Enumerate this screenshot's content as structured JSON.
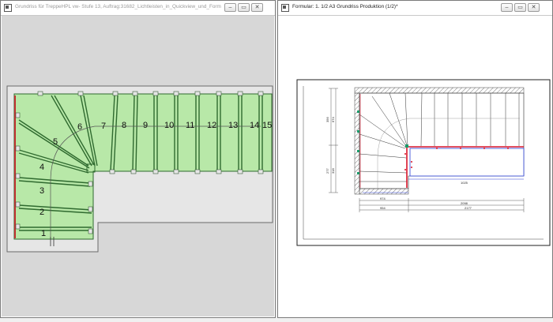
{
  "left_window": {
    "title": "Grundriss für TreppeHPL vw- Stufe 13, Auftrag:31682_Lichtleisten_in_Quickview_und_Form",
    "icon": "floorplan-window-icon",
    "controls": {
      "minimize": "–",
      "maximize": "▭",
      "close": "✕"
    },
    "step_numbers": [
      "1",
      "2",
      "3",
      "4",
      "5",
      "6",
      "7",
      "8",
      "9",
      "10",
      "11",
      "12",
      "13",
      "14",
      "15"
    ],
    "colors": {
      "tread_fill": "#b8e8a8",
      "step_line": "#2f6a2f",
      "wall": "#808080",
      "background": "#d7d7d7"
    }
  },
  "right_window": {
    "title": "Formular: 1. 1/2 A3 Grundriss Produktion (1/2)*",
    "icon": "form-window-icon",
    "controls": {
      "minimize": "–",
      "maximize": "▭",
      "close": "✕"
    },
    "drawing_labels": {
      "dim_left_1": "356",
      "dim_left_2": "674",
      "dim_left_3": "277",
      "dim_left_4": "318",
      "dim_inner_width": "1025",
      "dim_bottom_1": "974",
      "dim_bottom_2": "2098",
      "dim_bottom_3": "954",
      "dim_bottom_4": "2177"
    },
    "colors": {
      "red_rail": "#d8152a",
      "blue_line": "#2a3fd6",
      "hatch": "#555555"
    }
  }
}
